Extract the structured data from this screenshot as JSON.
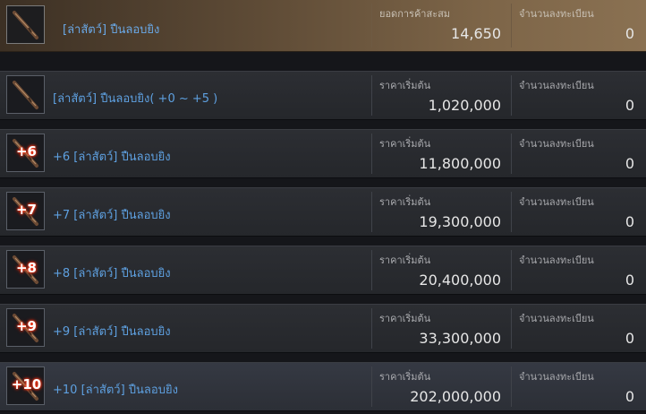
{
  "header": {
    "name": "[ล่าสัตว์] ปืนลอบยิง",
    "total_trades_label": "ยอดการค้าสะสม",
    "total_trades_value": "14,650",
    "registered_label": "จำนวนลงทะเบียน",
    "registered_value": "0",
    "icon": "rifle-icon"
  },
  "items": [
    {
      "name": "[ล่าสัตว์] ปืนลอบยิง( +0 ~ +5 )",
      "enhance": "",
      "price_label": "ราคาเริ่มต้น",
      "price": "1,020,000",
      "registered_label": "จำนวนลงทะเบียน",
      "registered": "0"
    },
    {
      "name": "+6 [ล่าสัตว์] ปืนลอบยิง",
      "enhance": "+6",
      "price_label": "ราคาเริ่มต้น",
      "price": "11,800,000",
      "registered_label": "จำนวนลงทะเบียน",
      "registered": "0"
    },
    {
      "name": "+7 [ล่าสัตว์] ปืนลอบยิง",
      "enhance": "+7",
      "price_label": "ราคาเริ่มต้น",
      "price": "19,300,000",
      "registered_label": "จำนวนลงทะเบียน",
      "registered": "0"
    },
    {
      "name": "+8 [ล่าสัตว์] ปืนลอบยิง",
      "enhance": "+8",
      "price_label": "ราคาเริ่มต้น",
      "price": "20,400,000",
      "registered_label": "จำนวนลงทะเบียน",
      "registered": "0"
    },
    {
      "name": "+9 [ล่าสัตว์] ปืนลอบยิง",
      "enhance": "+9",
      "price_label": "ราคาเริ่มต้น",
      "price": "33,300,000",
      "registered_label": "จำนวนลงทะเบียน",
      "registered": "0"
    },
    {
      "name": "+10 [ล่าสัตว์] ปืนลอบยิง",
      "enhance": "+10",
      "price_label": "ราคาเริ่มต้น",
      "price": "202,000,000",
      "registered_label": "จำนวนลงทะเบียน",
      "registered": "0"
    }
  ],
  "colors": {
    "item_name": "#5ea0e0",
    "enhance_glow": "#ff3a1a",
    "header_bg": "#7d6548"
  }
}
